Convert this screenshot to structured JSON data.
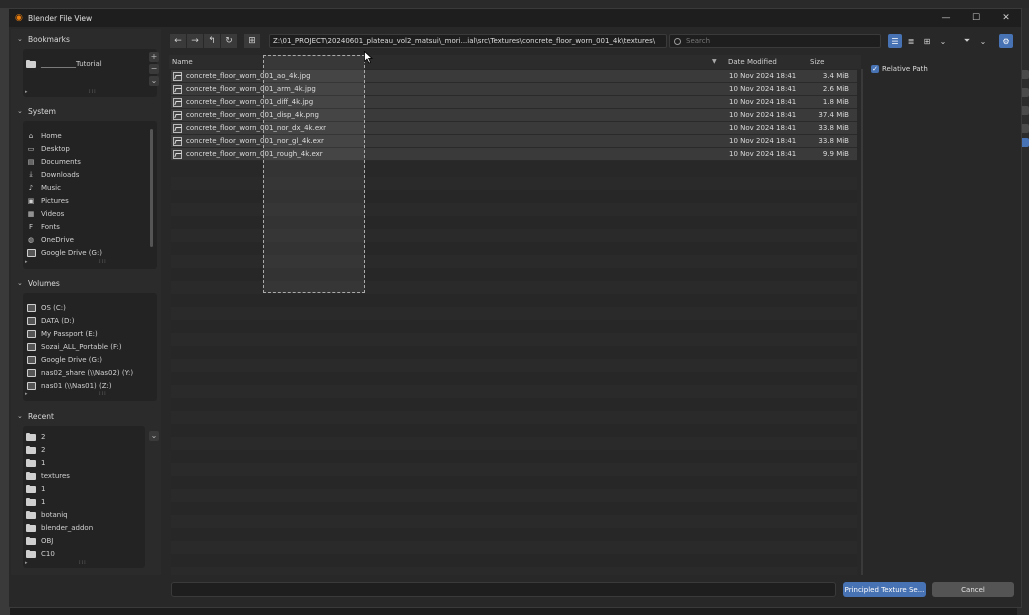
{
  "window": {
    "title": "Blender File View",
    "controls": {
      "minimize": "—",
      "maximize": "☐",
      "close": "✕"
    }
  },
  "colors": {
    "accent": "#4772b3",
    "background": "#282828",
    "row": "#3a3a3a",
    "logo": "#e87d0d"
  },
  "sidebar": {
    "bookmarks": {
      "header": "Bookmarks",
      "items": [
        {
          "label": "__________Tutorial",
          "icon": "folder-icon"
        }
      ]
    },
    "system": {
      "header": "System",
      "items": [
        {
          "label": "Home",
          "icon": "home-icon"
        },
        {
          "label": "Desktop",
          "icon": "desktop-icon"
        },
        {
          "label": "Documents",
          "icon": "documents-icon"
        },
        {
          "label": "Downloads",
          "icon": "downloads-icon"
        },
        {
          "label": "Music",
          "icon": "music-icon"
        },
        {
          "label": "Pictures",
          "icon": "pictures-icon"
        },
        {
          "label": "Videos",
          "icon": "videos-icon"
        },
        {
          "label": "Fonts",
          "icon": "fonts-icon"
        },
        {
          "label": "OneDrive",
          "icon": "onedrive-icon"
        },
        {
          "label": "Google Drive (G:)",
          "icon": "drive-icon"
        }
      ]
    },
    "volumes": {
      "header": "Volumes",
      "items": [
        {
          "label": "OS (C:)",
          "icon": "drive-icon"
        },
        {
          "label": "DATA (D:)",
          "icon": "drive-icon"
        },
        {
          "label": "My Passport (E:)",
          "icon": "drive-icon"
        },
        {
          "label": "Sozai_ALL_Portable (F:)",
          "icon": "drive-icon"
        },
        {
          "label": "Google Drive (G:)",
          "icon": "drive-icon"
        },
        {
          "label": "nas02_share (\\\\Nas02) (Y:)",
          "icon": "network-drive-icon"
        },
        {
          "label": "nas01 (\\\\Nas01) (Z:)",
          "icon": "network-drive-icon"
        }
      ]
    },
    "recent": {
      "header": "Recent",
      "items": [
        {
          "label": "2",
          "icon": "folder-icon"
        },
        {
          "label": "2",
          "icon": "folder-icon"
        },
        {
          "label": "1",
          "icon": "folder-icon"
        },
        {
          "label": "textures",
          "icon": "folder-icon"
        },
        {
          "label": "1",
          "icon": "folder-icon"
        },
        {
          "label": "1",
          "icon": "folder-icon"
        },
        {
          "label": "botaniq",
          "icon": "folder-icon"
        },
        {
          "label": "blender_addon",
          "icon": "folder-icon"
        },
        {
          "label": "OBJ",
          "icon": "folder-icon"
        },
        {
          "label": "C10",
          "icon": "folder-icon"
        }
      ]
    }
  },
  "toolbar": {
    "path": "Z:\\01_PROJECT\\20240601_plateau_vol2_matsui\\_mori...ial\\src\\Textures\\concrete_floor_worn_001_4k\\textures\\",
    "search_placeholder": "Search"
  },
  "filelist": {
    "columns": {
      "name": "Name",
      "date": "Date Modified",
      "size": "Size"
    },
    "files": [
      {
        "name": "concrete_floor_worn_001_ao_4k.jpg",
        "date": "10 Nov 2024 18:41",
        "size": "3.4 MiB"
      },
      {
        "name": "concrete_floor_worn_001_arm_4k.jpg",
        "date": "10 Nov 2024 18:41",
        "size": "2.6 MiB"
      },
      {
        "name": "concrete_floor_worn_001_diff_4k.jpg",
        "date": "10 Nov 2024 18:41",
        "size": "1.8 MiB"
      },
      {
        "name": "concrete_floor_worn_001_disp_4k.png",
        "date": "10 Nov 2024 18:41",
        "size": "37.4 MiB"
      },
      {
        "name": "concrete_floor_worn_001_nor_dx_4k.exr",
        "date": "10 Nov 2024 18:41",
        "size": "33.8 MiB"
      },
      {
        "name": "concrete_floor_worn_001_nor_gl_4k.exr",
        "date": "10 Nov 2024 18:41",
        "size": "33.8 MiB"
      },
      {
        "name": "concrete_floor_worn_001_rough_4k.exr",
        "date": "10 Nov 2024 18:41",
        "size": "9.9 MiB"
      }
    ]
  },
  "options": {
    "relative_path": {
      "label": "Relative Path",
      "checked": true
    }
  },
  "bottom": {
    "filename_value": "",
    "confirm_label": "Principled Texture Se...",
    "cancel_label": "Cancel"
  }
}
